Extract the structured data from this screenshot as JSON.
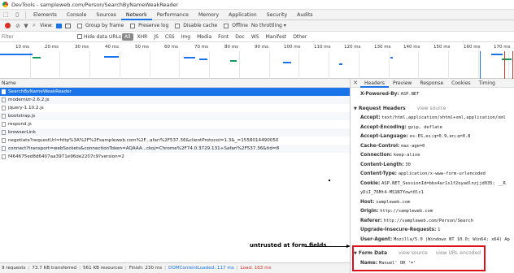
{
  "window": {
    "title": "DevTools - sampleweb.com/Person/SearchByNameWeakReader"
  },
  "devtools_tabs": [
    "Elements",
    "Console",
    "Sources",
    "Network",
    "Performance",
    "Memory",
    "Application",
    "Security",
    "Audits"
  ],
  "active_tab": "Network",
  "toolbar": {
    "view_label": "View:",
    "group_by_frame": "Group by frame",
    "preserve_log": "Preserve log",
    "disable_cache": "Disable cache",
    "offline": "Offline",
    "throttling": "No throttling"
  },
  "filter": {
    "placeholder": "Filter",
    "hide_data_urls": "Hide data URLs",
    "types": [
      "All",
      "XHR",
      "JS",
      "CSS",
      "Img",
      "Media",
      "Font",
      "Doc",
      "WS",
      "Manifest",
      "Other"
    ]
  },
  "timeline": {
    "ticks": [
      "10 ms",
      "20 ms",
      "30 ms",
      "40 ms",
      "50 ms",
      "60 ms",
      "70 ms",
      "80 ms",
      "90 ms",
      "100 ms",
      "110 ms",
      "120 ms",
      "130 ms",
      "140 ms",
      "150 ms",
      "160 ms",
      "170 ms"
    ],
    "colors": {
      "blue": "#1a73e8",
      "green": "#0f9d58",
      "red": "#d93025"
    }
  },
  "list": {
    "column_name": "Name",
    "requests": [
      "SearchByNameWeakReader",
      "modernizr-2.6.2.js",
      "jquery-1.10.2.js",
      "bootstrap.js",
      "respond.js",
      "browserLink",
      "negotiate?requestUrl=http%3A%2F%2Fsampleweb.com%2F...afari%2F537.36&clientProtocol=1.3&_=1558014490050",
      "connect?transport=webSockets&connectionToken=AQAAA...ckoj=Chrome%2F74.0.3729.131+Safari%2F537.36&tid=8",
      "f464675ed8d6407aa3971e96de2207c9?version=2"
    ],
    "selected_index": 0
  },
  "summary": {
    "requests": "9 requests",
    "transferred": "73.7 KB transferred",
    "resources": "561 KB resources",
    "finish": "Finish: 230 ms",
    "dom_content_loaded": "DOMContentLoaded: 117 ms",
    "load": "Load: 163 ms"
  },
  "detail": {
    "tabs": [
      "Headers",
      "Preview",
      "Response",
      "Cookies",
      "Timing"
    ],
    "active_tab": "Headers",
    "powered_by": {
      "key": "X-Powered-By:",
      "value": "ASP.NET"
    },
    "request_headers_title": "Request Headers",
    "view_source": "view source",
    "headers": [
      {
        "key": "Accept:",
        "value": "text/html,application/xhtml+xml,application/xml"
      },
      {
        "key": "Accept-Encoding:",
        "value": "gzip, deflate"
      },
      {
        "key": "Accept-Language:",
        "value": "es-ES,es;q=0.9,en;q=0.8"
      },
      {
        "key": "Cache-Control:",
        "value": "max-age=0"
      },
      {
        "key": "Connection:",
        "value": "keep-alive"
      },
      {
        "key": "Content-Length:",
        "value": "30"
      },
      {
        "key": "Content-Type:",
        "value": "application/x-www-form-urlencoded"
      },
      {
        "key": "Cookie:",
        "value": "ASP.NET_SessionId=bbs4ar1s1f2oyadlnzjjd035; __R"
      },
      {
        "key": "",
        "value": "yDiI_76Mt4-MS1N7Yowt0lc1"
      },
      {
        "key": "Host:",
        "value": "sampleweb.com"
      },
      {
        "key": "Origin:",
        "value": "http://sampleweb.com"
      },
      {
        "key": "Referer:",
        "value": "http://sampleweb.com/Person/Search"
      },
      {
        "key": "Upgrade-Insecure-Requests:",
        "value": "1"
      },
      {
        "key": "User-Agent:",
        "value": "Mozilla/5.0 (Windows NT 10.0; Win64; x64) Ap"
      }
    ],
    "form_data_title": "Form Data",
    "view_url_encoded": "view URL encoded",
    "form_name_key": "Name:",
    "form_name_value": "Manuel' OR '='"
  },
  "annotation": {
    "text": "untrusted at form fields",
    "color": "#e0101a"
  }
}
